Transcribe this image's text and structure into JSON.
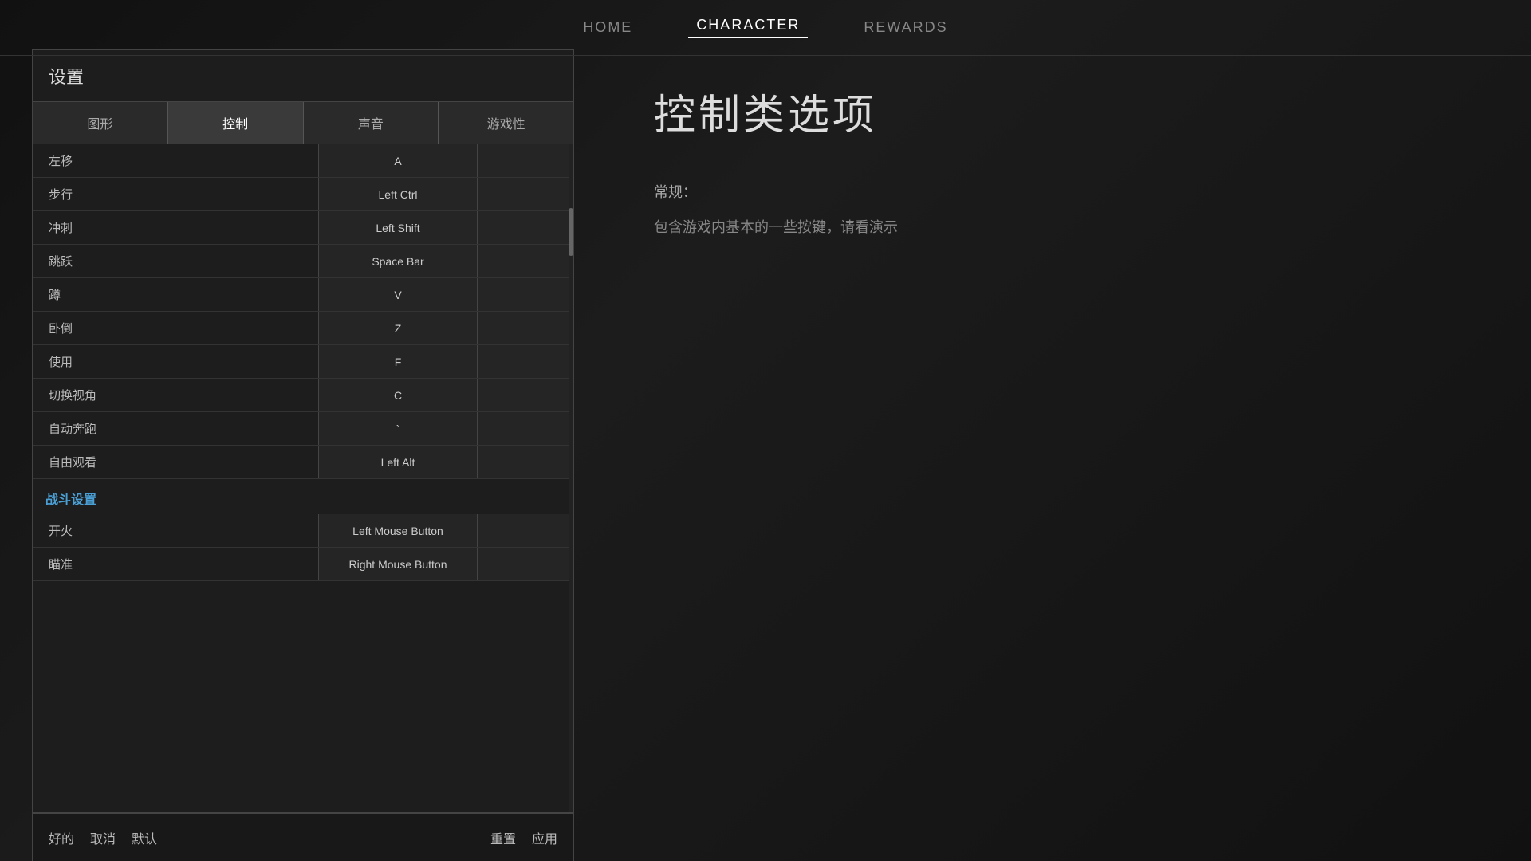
{
  "nav": {
    "items": [
      {
        "label": "HOME",
        "active": false
      },
      {
        "label": "CHARACTER",
        "active": true
      },
      {
        "label": "REWARDS",
        "active": false
      }
    ]
  },
  "settings": {
    "title": "设置",
    "tabs": [
      {
        "label": "图形",
        "active": false
      },
      {
        "label": "控制",
        "active": true
      },
      {
        "label": "声音",
        "active": false
      },
      {
        "label": "游戏性",
        "active": false
      }
    ],
    "sections": [
      {
        "header": null,
        "rows": [
          {
            "action": "左移",
            "primary": "A",
            "secondary": ""
          },
          {
            "action": "步行",
            "primary": "Left Ctrl",
            "secondary": ""
          },
          {
            "action": "冲刺",
            "primary": "Left Shift",
            "secondary": ""
          },
          {
            "action": "跳跃",
            "primary": "Space Bar",
            "secondary": ""
          },
          {
            "action": "蹲",
            "primary": "V",
            "secondary": ""
          },
          {
            "action": "卧倒",
            "primary": "Z",
            "secondary": ""
          },
          {
            "action": "使用",
            "primary": "F",
            "secondary": ""
          },
          {
            "action": "切换视角",
            "primary": "C",
            "secondary": ""
          },
          {
            "action": "自动奔跑",
            "primary": "`",
            "secondary": ""
          },
          {
            "action": "自由观看",
            "primary": "Left Alt",
            "secondary": ""
          }
        ]
      },
      {
        "header": "战斗设置",
        "rows": [
          {
            "action": "开火",
            "primary": "Left Mouse Button",
            "secondary": ""
          },
          {
            "action": "瞄准",
            "primary": "Right Mouse Button",
            "secondary": ""
          }
        ]
      }
    ],
    "bottom": {
      "left": [
        "好的",
        "取消",
        "默认"
      ],
      "right": [
        "重置",
        "应用"
      ]
    }
  },
  "right_panel": {
    "title": "控制类选项",
    "section_label": "常规：",
    "description": "包含游戏内基本的一些按键，请看演示"
  }
}
